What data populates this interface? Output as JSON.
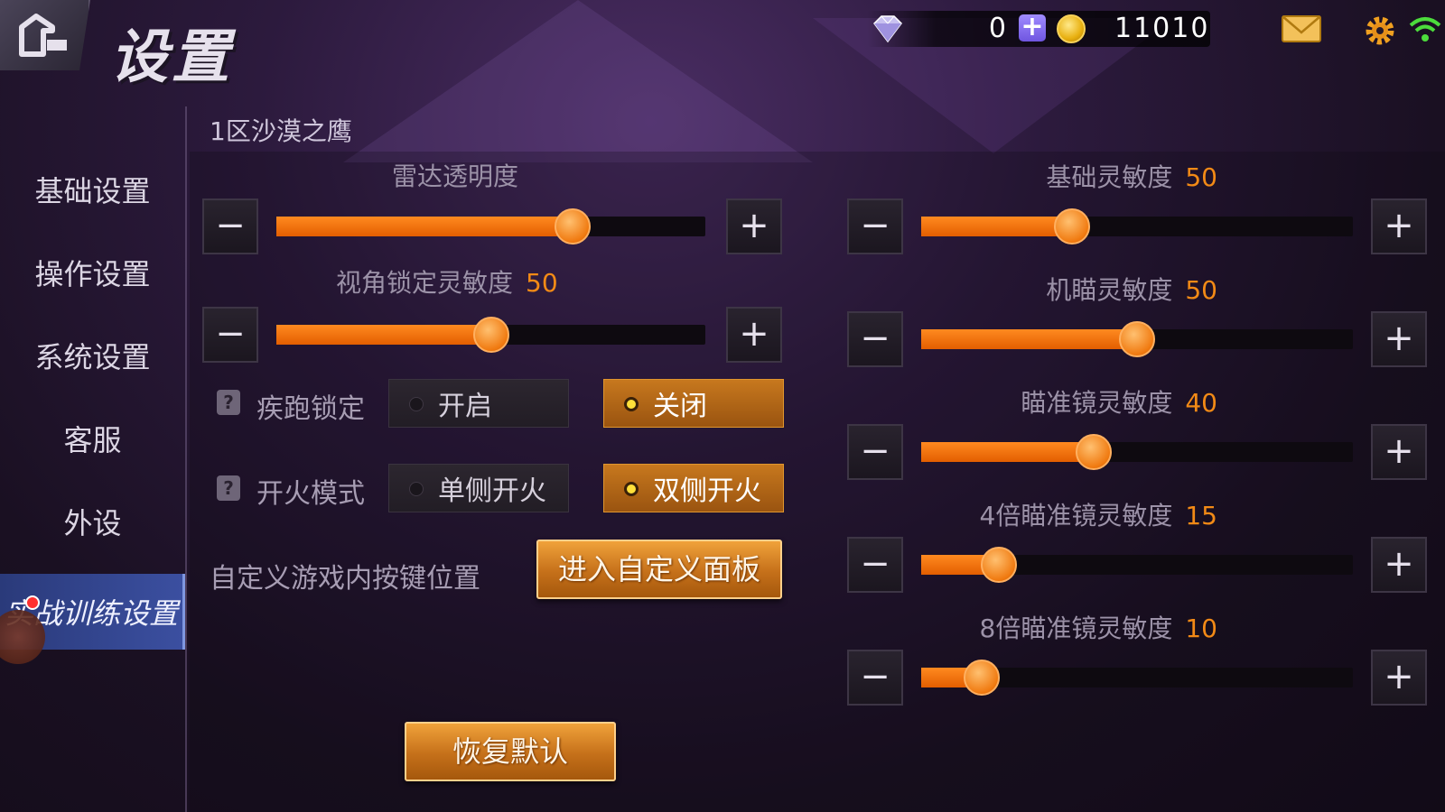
{
  "header": {
    "title": "设置",
    "diamonds": "0",
    "coins": "11010"
  },
  "sidebar": {
    "items": [
      {
        "label": "基础设置"
      },
      {
        "label": "操作设置"
      },
      {
        "label": "系统设置"
      },
      {
        "label": "客服"
      },
      {
        "label": "外设"
      },
      {
        "label": "实战训练设置",
        "active": true
      }
    ]
  },
  "server_label": "1区沙漠之鹰",
  "left_sliders": [
    {
      "label": "雷达透明度",
      "value_text": "",
      "fraction": 0.69
    },
    {
      "label": "视角锁定灵敏度",
      "value_text": "50",
      "fraction": 0.5
    }
  ],
  "right_sliders": [
    {
      "label": "基础灵敏度",
      "value_text": "50",
      "fraction": 0.35
    },
    {
      "label": "机瞄灵敏度",
      "value_text": "50",
      "fraction": 0.5
    },
    {
      "label": "瞄准镜灵敏度",
      "value_text": "40",
      "fraction": 0.4
    },
    {
      "label": "4倍瞄准镜灵敏度",
      "value_text": "15",
      "fraction": 0.18
    },
    {
      "label": "8倍瞄准镜灵敏度",
      "value_text": "10",
      "fraction": 0.14
    }
  ],
  "toggles": {
    "sprint_lock": {
      "label": "疾跑锁定",
      "options": [
        "开启",
        "关闭"
      ],
      "selected": "关闭"
    },
    "fire_mode": {
      "label": "开火模式",
      "options": [
        "单侧开火",
        "双侧开火"
      ],
      "selected": "双侧开火"
    }
  },
  "custom_layout": {
    "label": "自定义游戏内按键位置",
    "button": "进入自定义面板"
  },
  "reset_button": "恢复默认",
  "step": {
    "minus": "−",
    "plus": "+"
  },
  "colors": {
    "accent": "#f28a16",
    "active_tab": "#3b4fa0"
  }
}
